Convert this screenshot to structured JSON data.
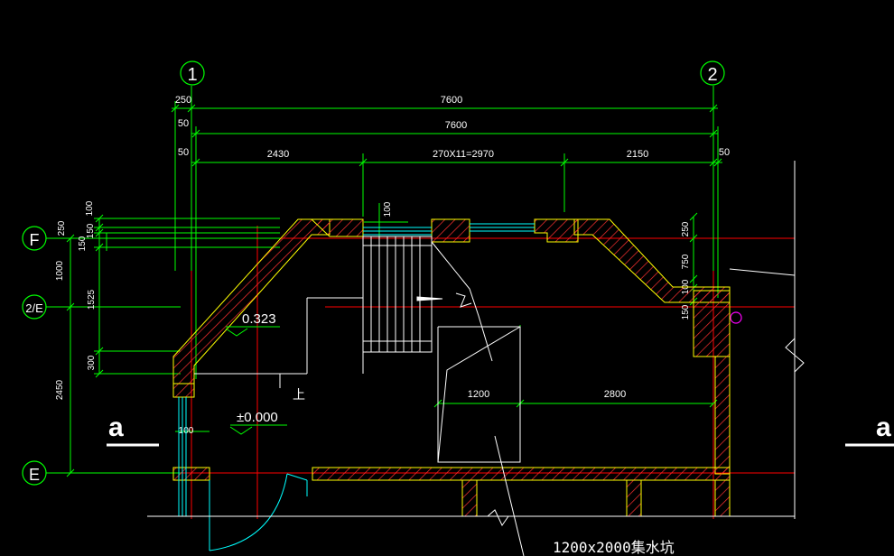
{
  "colors": {
    "background": "#000000",
    "dimension": "#00ff00",
    "wall_outline": "#ffff00",
    "hatch": "#ff3030",
    "axis_red": "#ff0000",
    "white": "#ffffff",
    "cyan": "#00ffff",
    "magenta": "#ff00ff",
    "text": "#ffffff"
  },
  "axes": {
    "col_1": "1",
    "col_2": "2",
    "row_F": "F",
    "row_2E": "2/E",
    "row_E": "E"
  },
  "dims": {
    "top_overall": "7600",
    "top_overall_2": "7600",
    "left_250": "250",
    "left_50_a": "50",
    "left_50_b": "50",
    "right_50": "50",
    "seg_2430": "2430",
    "seg_stair": "270X11=2970",
    "seg_2150": "2150",
    "v_100_top": "100",
    "v_250": "250",
    "v_150": "150",
    "v_150b": "150",
    "v_1000": "1000",
    "v_1525": "1525",
    "v_300": "300",
    "v_2450": "2450",
    "v_100_win": "100",
    "r_250": "250",
    "r_750": "750",
    "r_100": "100",
    "r_150": "150",
    "inner_1200": "1200",
    "inner_2800": "2800",
    "door_100": "100"
  },
  "labels": {
    "elev_upper": "0.323",
    "elev_lower": "±0.000",
    "stair_up": "上",
    "section_left": "a",
    "section_right": "a",
    "pit_note": "1200x2000集水坑"
  }
}
